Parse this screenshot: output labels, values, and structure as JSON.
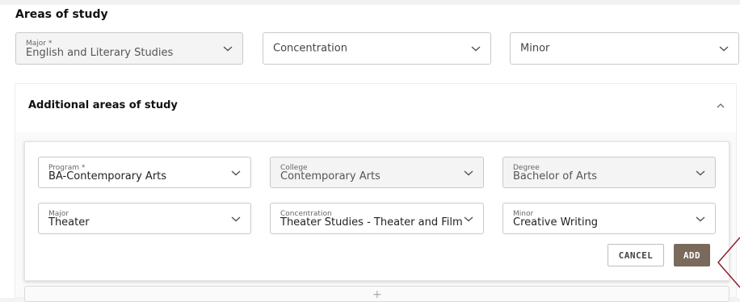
{
  "section_title": "Areas of study",
  "primary": {
    "major": {
      "label": "Major *",
      "value": "English and Literary Studies"
    },
    "concentration": {
      "placeholder": "Concentration"
    },
    "minor": {
      "placeholder": "Minor"
    }
  },
  "additional": {
    "title": "Additional areas of study",
    "program": {
      "label": "Program *",
      "value": "BA-Contemporary Arts"
    },
    "college": {
      "label": "College",
      "value": "Contemporary Arts"
    },
    "degree": {
      "label": "Degree",
      "value": "Bachelor of Arts"
    },
    "major": {
      "label": "Major",
      "value": "Theater"
    },
    "concentration": {
      "label": "Concentration",
      "value": "Theater Studies - Theater and Film"
    },
    "minor": {
      "label": "Minor",
      "value": "Creative Writing"
    },
    "cancel_label": "CANCEL",
    "add_label": "ADD",
    "add_more_symbol": "+"
  },
  "colors": {
    "add_button": "#7a6a5b",
    "pointer": "#8b1c2b"
  }
}
